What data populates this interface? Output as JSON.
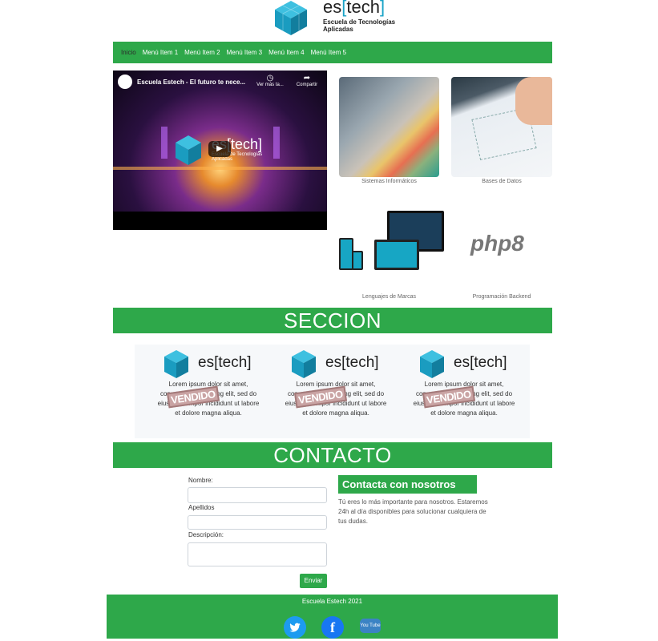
{
  "header": {
    "logo_prefix": "es",
    "logo_bracket_open": "[",
    "logo_main": "tech",
    "logo_bracket_close": "]",
    "logo_subtitle": "Escuela de Tecnologías Aplicadas"
  },
  "nav": {
    "items": [
      "Inicio",
      "Menú Item 1",
      "Menú Item 2",
      "Menú Item 3",
      "Menú Item 4",
      "Menú Item 5"
    ]
  },
  "video": {
    "title": "Escuela Estech - El futuro te nece...",
    "watch_later": "Ver más ta...",
    "share": "Compartir",
    "inner_logo": "es[tech]",
    "inner_sub": "Escuela de Tecnologías Aplicadas"
  },
  "gallery": {
    "captions": [
      "Sistemas Informáticos",
      "Bases de Datos",
      "Lenguajes de Marcas",
      "Programación Backend"
    ],
    "php_logo_text": "php8"
  },
  "section": {
    "title": "SECCION",
    "card_logo": "es[tech]",
    "card_text": "Lorem ipsum dolor sit amet, consectetur adipiscing elit, sed do eiusmod tempor incididunt ut labore et dolore magna aliqua.",
    "stamp": "VENDIDO"
  },
  "contact": {
    "title": "CONTACTO",
    "name_label": "Nombre:",
    "surname_label": "Apellidos",
    "desc_label": "Descripción:",
    "submit": "Enviar",
    "box_title": "Contacta con nosotros",
    "box_text": "Tú eres lo más importante para nosotros. Estaremos 24h al día disponibles para solucionar cualquiera de tus dudas."
  },
  "footer": {
    "text": "Escuela Estech 2021",
    "social": [
      "twitter",
      "facebook",
      "youtube"
    ],
    "youtube_label": "You Tube"
  },
  "colors": {
    "brand_green": "#2ea84a",
    "brand_blue": "#1aa3c7"
  }
}
